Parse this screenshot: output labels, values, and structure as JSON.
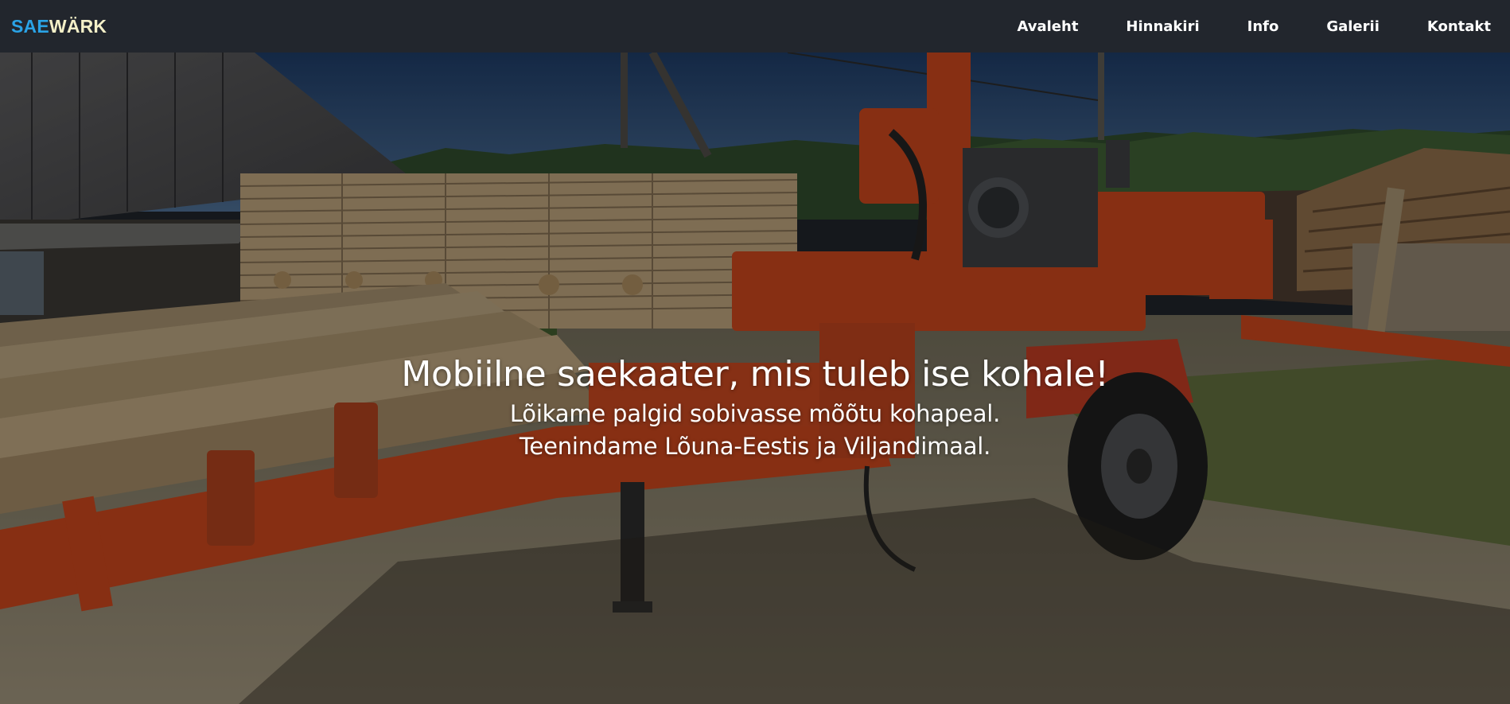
{
  "brand": {
    "part1": "SAE",
    "part2": "WÄRK",
    "colors": {
      "part1": "#2aa3e6",
      "part2": "#f4f0c8"
    }
  },
  "nav": {
    "items": [
      {
        "label": "Avaleht"
      },
      {
        "label": "Hinnakiri"
      },
      {
        "label": "Info"
      },
      {
        "label": "Galerii"
      },
      {
        "label": "Kontakt"
      }
    ]
  },
  "hero": {
    "title": "Mobiilne saekaater, mis tuleb ise kohale!",
    "subtitle_line1": "Lõikame palgid sobivasse mõõtu kohapeal.",
    "subtitle_line2": "Teenindame Lõuna-Eestis ja Viljandimaal."
  },
  "colors": {
    "navbar_bg": "#22262d",
    "machine_orange": "#c2441c"
  }
}
